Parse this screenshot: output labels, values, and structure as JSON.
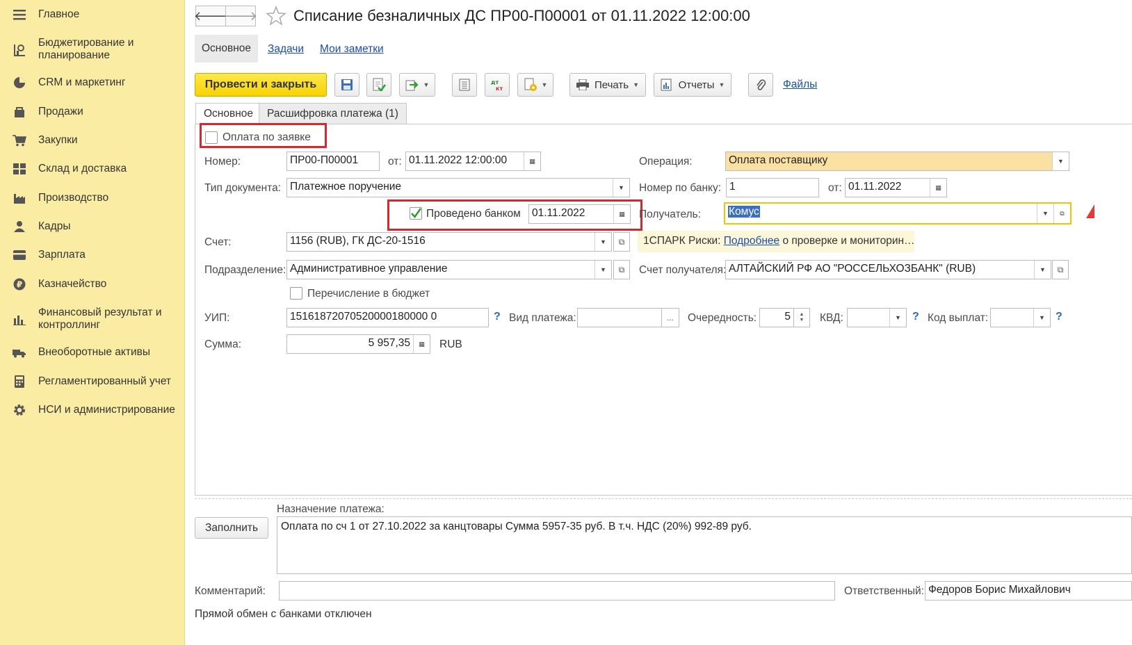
{
  "sidebar": {
    "items": [
      {
        "label": "Главное",
        "icon": "menu-icon"
      },
      {
        "label": "Бюджетирование и планирование",
        "icon": "budget-icon"
      },
      {
        "label": "CRM и маркетинг",
        "icon": "pie-chart-icon"
      },
      {
        "label": "Продажи",
        "icon": "shopping-bag-icon"
      },
      {
        "label": "Закупки",
        "icon": "cart-icon"
      },
      {
        "label": "Склад и доставка",
        "icon": "warehouse-icon"
      },
      {
        "label": "Производство",
        "icon": "factory-icon"
      },
      {
        "label": "Кадры",
        "icon": "person-icon"
      },
      {
        "label": "Зарплата",
        "icon": "card-icon"
      },
      {
        "label": "Казначейство",
        "icon": "ruble-icon"
      },
      {
        "label": "Финансовый результат и контроллинг",
        "icon": "bar-chart-icon"
      },
      {
        "label": "Внеоборотные активы",
        "icon": "truck-icon"
      },
      {
        "label": "Регламентированный учет",
        "icon": "calculator-icon"
      },
      {
        "label": "НСИ и администрирование",
        "icon": "gear-icon"
      }
    ]
  },
  "header": {
    "title": "Списание безналичных ДС ПР00-П00001 от 01.11.2022 12:00:00",
    "subtabs": [
      "Основное",
      "Задачи",
      "Мои заметки"
    ]
  },
  "toolbar": {
    "post_close": "Провести и закрыть",
    "print": "Печать",
    "reports": "Отчеты",
    "files": "Файлы"
  },
  "tabs": [
    "Основное",
    "Расшифровка платежа (1)"
  ],
  "form": {
    "pay_by_request": "Оплата по заявке",
    "number_label": "Номер:",
    "number_value": "ПР00-П00001",
    "from_label": "от:",
    "date_value": "01.11.2022 12:00:00",
    "operation_label": "Операция:",
    "operation_value": "Оплата поставщику",
    "doctype_label": "Тип документа:",
    "doctype_value": "Платежное поручение",
    "bank_number_label": "Номер по банку:",
    "bank_number_value": "1",
    "bank_from_label": "от:",
    "bank_date_value": "01.11.2022",
    "posted_by_bank": "Проведено банком",
    "posted_date": "01.11.2022",
    "recipient_label": "Получатель:",
    "recipient_value": "Комус",
    "account_label": "Счет:",
    "account_value": "1156 (RUB), ГК ДС-20-1516",
    "spark_prefix": "1СПАРК Риски: ",
    "spark_link": "Подробнее",
    "spark_suffix": " о проверке и мониторин…",
    "division_label": "Подразделение:",
    "division_value": "Административное управление",
    "recipient_account_label": "Счет получателя:",
    "recipient_account_value": "АЛТАЙСКИЙ РФ АО \"РОССЕЛЬХОЗБАНК\" (RUB)",
    "budget_transfer": "Перечисление в бюджет",
    "uip_label": "УИП:",
    "uip_value": "15161872070520000180000 0",
    "payment_type_label": "Вид платежа:",
    "order_label": "Очередность:",
    "order_value": "5",
    "kvd_label": "КВД:",
    "payout_code_label": "Код выплат:",
    "sum_label": "Сумма:",
    "sum_value": "5 957,35",
    "currency": "RUB",
    "qmark": "?",
    "ellipsis": "..."
  },
  "bottom": {
    "fill_button": "Заполнить",
    "purpose_label": "Назначение платежа:",
    "purpose_value": "Оплата по сч 1 от 27.10.2022 за канцтовары Сумма 5957-35 руб. В т.ч. НДС (20%) 992-89 руб.",
    "comment_label": "Комментарий:",
    "responsible_label": "Ответственный:",
    "responsible_value": "Федоров Борис Михайлович",
    "status_text": "Прямой обмен с банками отключен"
  },
  "colors": {
    "sidebar_bg": "#fbeca3",
    "accent_yellow": "#f7d203",
    "highlight_red": "#d7262e",
    "link_blue": "#1a4eab"
  }
}
